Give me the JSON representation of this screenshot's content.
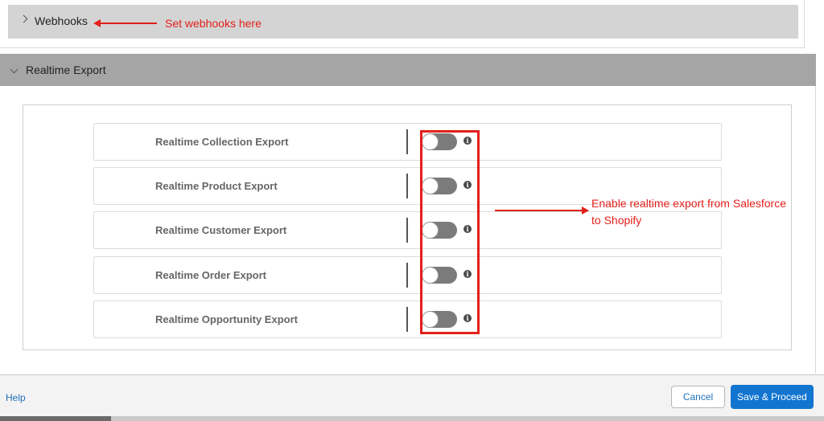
{
  "webhooks": {
    "title": "Webhooks",
    "annotation": "Set webhooks here"
  },
  "realtime_export": {
    "title": "Realtime Export",
    "rows": [
      {
        "label": "Realtime Collection Export",
        "enabled": false
      },
      {
        "label": "Realtime Product Export",
        "enabled": false
      },
      {
        "label": "Realtime Customer Export",
        "enabled": false
      },
      {
        "label": "Realtime Order Export",
        "enabled": false
      },
      {
        "label": "Realtime Opportunity Export",
        "enabled": false
      }
    ],
    "info_glyph": "i",
    "annotation_line1": "Enable realtime export from Salesforce",
    "annotation_line2": "to Shopify"
  },
  "footer": {
    "help_label": "Help",
    "cancel_label": "Cancel",
    "save_label": "Save & Proceed"
  },
  "colors": {
    "annotation": "#e3201b",
    "primary_button": "#1275d0",
    "toggle_off": "#7b7b7b",
    "section_header": "#a5a5a5"
  },
  "icons": {
    "collapsed": "chevron-right-icon",
    "expanded": "chevron-down-icon",
    "info": "info-icon"
  }
}
